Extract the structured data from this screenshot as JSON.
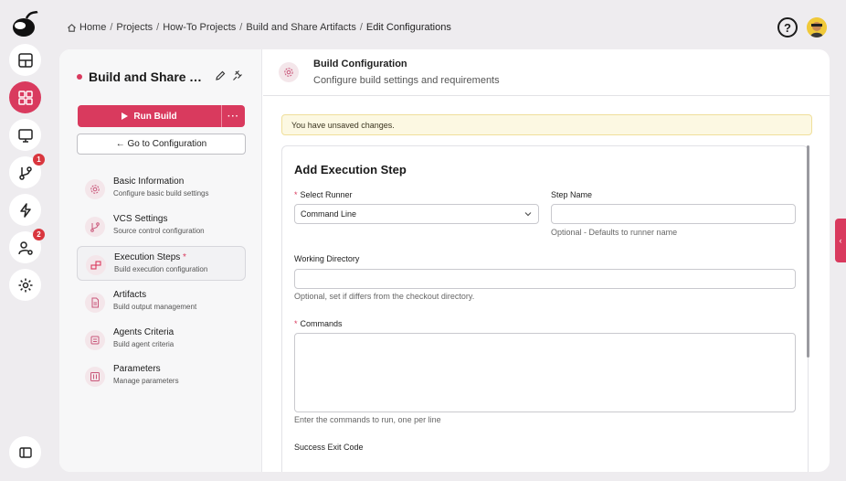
{
  "breadcrumb": {
    "items": [
      "Home",
      "Projects",
      "How-To Projects",
      "Build and Share Artifacts"
    ],
    "current": "Edit Configurations"
  },
  "rail": {
    "badges": {
      "pull_requests": "1",
      "user_settings": "2"
    }
  },
  "header": {
    "help_label": "?"
  },
  "panel": {
    "title": "Build and Share Artifacts",
    "run_button_label": "Run Build",
    "more_button_label": "···",
    "goto_button_label": "← Go to Configuration",
    "nav": [
      {
        "title": "Basic Information",
        "subtitle": "Configure basic build settings",
        "icon": "gear-icon"
      },
      {
        "title": "VCS Settings",
        "subtitle": "Source control configuration",
        "icon": "branch-icon"
      },
      {
        "title": "Execution Steps",
        "subtitle": "Build execution configuration",
        "required_mark": "*",
        "icon": "steps-icon",
        "active": true
      },
      {
        "title": "Artifacts",
        "subtitle": "Build output management",
        "icon": "file-icon"
      },
      {
        "title": "Agents Criteria",
        "subtitle": "Build agent criteria",
        "icon": "agent-icon"
      },
      {
        "title": "Parameters",
        "subtitle": "Manage parameters",
        "icon": "parameters-icon"
      }
    ]
  },
  "content": {
    "title": "Build Configuration",
    "subtitle": "Configure build settings and requirements",
    "notice": "You have unsaved changes.",
    "form": {
      "title": "Add Execution Step",
      "required_mark": "*",
      "runner_label": "Select Runner",
      "runner_value": "Command Line",
      "step_name_label": "Step Name",
      "step_name_value": "",
      "step_name_hint": "Optional - Defaults to runner name",
      "workdir_label": "Working Directory",
      "workdir_value": "",
      "workdir_hint": "Optional, set if differs from the checkout directory.",
      "commands_label": "Commands",
      "commands_hint": "Enter the commands to run, one per line",
      "exit_code_label": "Success Exit Code"
    }
  },
  "side_tab_label": "‹",
  "colors": {
    "accent": "#d93a5e",
    "notice_bg": "#fcf8e2",
    "background": "#eeecef"
  }
}
